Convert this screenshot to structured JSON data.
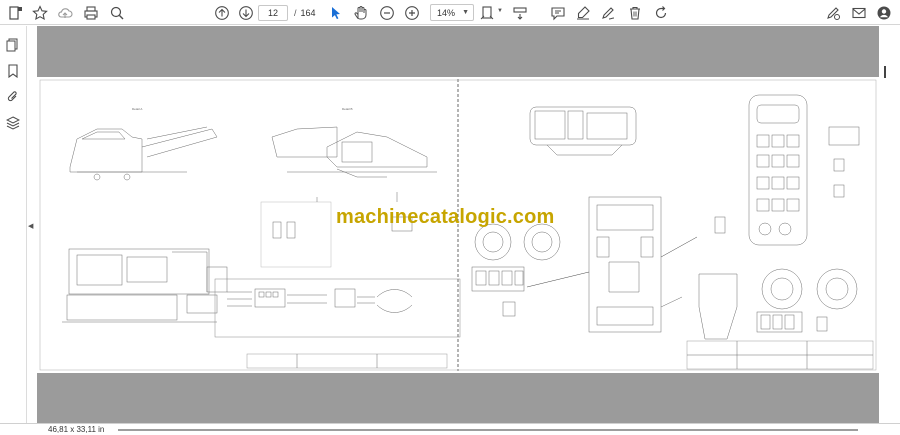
{
  "toolbar": {
    "page_current": "12",
    "page_separator": "/",
    "page_total": "164",
    "zoom": "14%",
    "icons": [
      "star-icon",
      "cloud-upload-icon",
      "print-icon",
      "zoom-search-icon",
      "arrow-up-icon",
      "arrow-down-icon",
      "cursor-icon",
      "hand-icon",
      "zoom-out-icon",
      "zoom-in-icon",
      "fit-page-icon",
      "scroll-mode-icon",
      "comment-icon",
      "highlight-icon",
      "draw-icon",
      "delete-icon",
      "rotate-icon",
      "sign-icon",
      "mail-icon",
      "account-icon"
    ]
  },
  "sidebar": {
    "icons": [
      "pages-icon",
      "bookmark-icon",
      "attachment-icon",
      "layers-icon"
    ]
  },
  "document": {
    "watermark": "machinecatalogic.com"
  },
  "status": {
    "dimensions": "46,81 x 33,11 in"
  },
  "colors": {
    "watermark": "#c7a500",
    "viewer_bg": "#9b9b9b",
    "drawing_line": "#555555"
  }
}
